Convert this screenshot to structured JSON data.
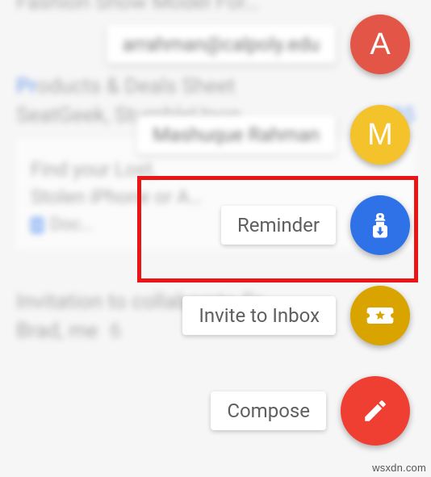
{
  "bg": {
    "row0": "Fashion Show Model For…",
    "row1_prefix": "Pr",
    "row1_rest": "oducts & Deals Sheet",
    "row2": "SeatGeek, StumbleUpon",
    "row2_count": "25",
    "card_line1": "Find your Lost,",
    "card_line2": "Stolen iPhone or A…",
    "card_doc": "Doc…",
    "row3": "Invitation to collaborate Gr…",
    "row4": "Brad, me",
    "row4_count": "6"
  },
  "fab": {
    "contact1_chip": "arrahman@calpoly.edu",
    "contact1_letter": "A",
    "contact1_color": "#e35647",
    "contact2_chip": "Mashuque Rahman",
    "contact2_letter": "M",
    "contact2_color": "#f4c22b",
    "reminder_label": "Reminder",
    "reminder_color": "#2f72e8",
    "invite_label": "Invite to Inbox",
    "invite_color": "#d9a400",
    "compose_label": "Compose",
    "compose_color": "#ef3f33"
  },
  "watermark": "wsxdn.com"
}
